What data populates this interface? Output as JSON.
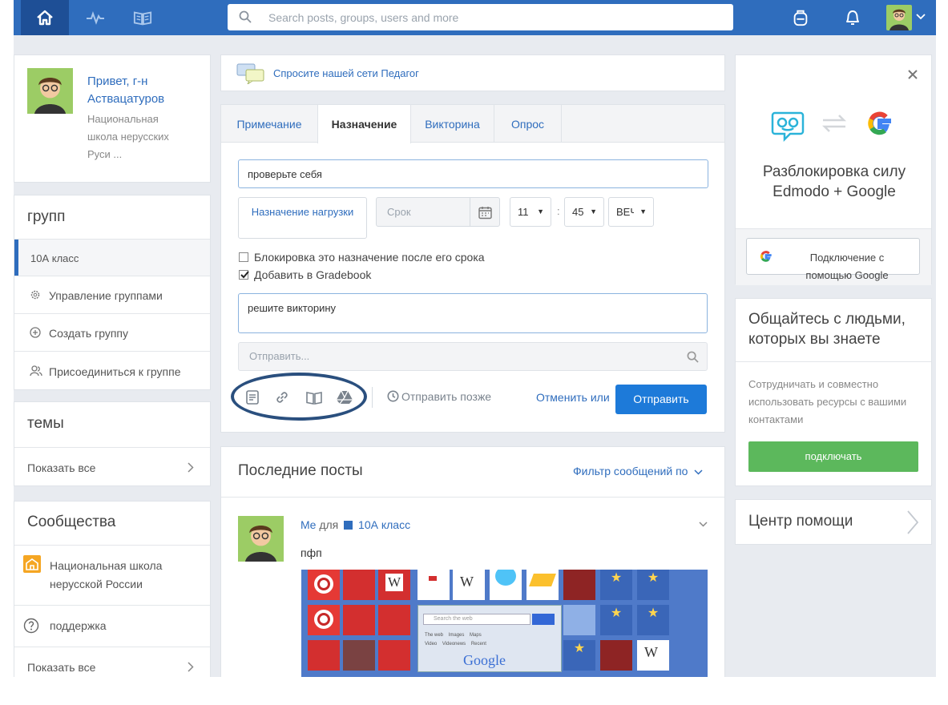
{
  "topbar": {
    "search_placeholder": "Search posts, groups, users and more",
    "icons": [
      "home-icon",
      "activity-icon",
      "book-icon",
      "backpack-icon",
      "bell-icon",
      "avatar",
      "chevron-down-icon"
    ]
  },
  "profile": {
    "greeting": "Привет, г-н Аствацатуров",
    "school": "Национальная школа нерусских Руси ..."
  },
  "groups": {
    "title": "групп",
    "items": [
      "10А класс",
      "Управление группами",
      "Создать группу",
      "Присоединиться к группе"
    ]
  },
  "topics": {
    "title": "темы",
    "show_all": "Показать все"
  },
  "communities": {
    "title": "Сообщества",
    "items": [
      "Национальная школа нерусской России",
      "поддержка"
    ],
    "show_all": "Показать все"
  },
  "ask": {
    "label": "Спросите нашей сети Педагог"
  },
  "composer": {
    "tabs": [
      "Примечание",
      "Назначение",
      "Викторина",
      "Опрос"
    ],
    "active_tab": "Назначение",
    "title_value": "проверьте себя",
    "load_assignment": "Назначение нагрузки",
    "due_placeholder": "Срок",
    "hour": "11",
    "minute": "45",
    "ampm": "ВЕЧ",
    "lock_label": "Блокировка это назначение после его срока",
    "gradebook_label": "Добавить в Gradebook",
    "lock_checked": false,
    "gradebook_checked": true,
    "description": "решите викторину",
    "send_to_placeholder": "Отправить...",
    "send_later": "Отправить позже",
    "cancel": "Отменить или",
    "send": "Отправить"
  },
  "feed": {
    "title": "Последние посты",
    "filter": "Фильтр сообщений по",
    "post": {
      "author": "Me",
      "for": "для",
      "group": "10А класс",
      "text": "пфп"
    }
  },
  "screenshot_embed": {
    "search_placeholder": "Search the web",
    "options": [
      "The web",
      "Images",
      "Maps",
      "Video",
      "Videonews",
      "Recent"
    ],
    "logo": "Google"
  },
  "promo": {
    "title": "Разблокировка силу Edmodo + Google",
    "connect": "Подключение с помощью Google"
  },
  "people": {
    "title": "Общайтесь с людьми, которых вы знаете",
    "desc": "Сотрудничать и совместно использовать ресурсы с вашими контактами",
    "button": "подключать"
  },
  "help": {
    "title": "Центр помощи"
  },
  "colors": {
    "brand_blue": "#2f6dbd",
    "green": "#5cb85c",
    "annotation": "#2a4f7e"
  }
}
